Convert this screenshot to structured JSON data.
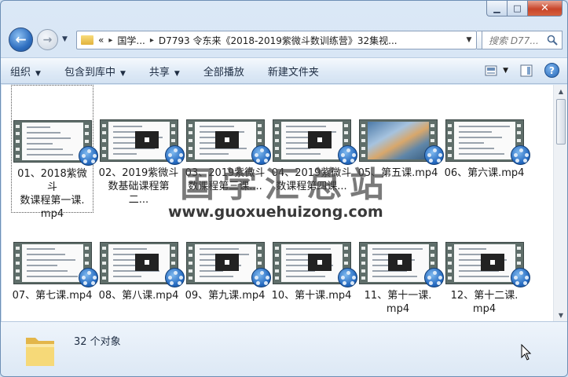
{
  "window": {
    "buttons": {
      "minimize": "▁",
      "maximize": "□",
      "close": "✕"
    }
  },
  "nav": {
    "back_icon": "arrow-left-icon",
    "forward_icon": "arrow-right-icon",
    "address": {
      "prefix": "«",
      "segments": [
        "国学...",
        "D7793 令东来《2018-2019紫微斗数训练营》32集视..."
      ]
    },
    "search_placeholder": "搜索 D77..."
  },
  "toolbar": {
    "items": [
      {
        "label": "组织",
        "dropdown": true
      },
      {
        "label": "包含到库中",
        "dropdown": true
      },
      {
        "label": "共享",
        "dropdown": true
      },
      {
        "label": "全部播放",
        "dropdown": false
      },
      {
        "label": "新建文件夹",
        "dropdown": false
      }
    ]
  },
  "files": [
    {
      "name": "01、2018紫微斗数课程第一课.mp4",
      "lines": [
        "01、2018紫微斗",
        "数课程第一课.",
        "mp4"
      ],
      "selected": true
    },
    {
      "name": "02、2019紫微斗数基础课程第二...",
      "lines": [
        "02、2019紫微斗",
        "数基础课程第二..."
      ],
      "selected": false
    },
    {
      "name": "03、2019紫微斗数课程第三课...",
      "lines": [
        "03、2019紫微斗",
        "数课程第三课...."
      ],
      "selected": false
    },
    {
      "name": "04、2019紫微斗数课程第四课...",
      "lines": [
        "04、2019紫微斗",
        "数课程第四课..."
      ],
      "selected": false
    },
    {
      "name": "05、第五课.mp4",
      "lines": [
        "05、第五课.mp4"
      ],
      "selected": false
    },
    {
      "name": "06、第六课.mp4",
      "lines": [
        "06、第六课.mp4"
      ],
      "selected": false
    },
    {
      "name": "07、第七课.mp4",
      "lines": [
        "07、第七课.mp4"
      ],
      "selected": false
    },
    {
      "name": "08、第八课.mp4",
      "lines": [
        "08、第八课.mp4"
      ],
      "selected": false
    },
    {
      "name": "09、第九课.mp4",
      "lines": [
        "09、第九课.mp4"
      ],
      "selected": false
    },
    {
      "name": "10、第十课.mp4",
      "lines": [
        "10、第十课.mp4"
      ],
      "selected": false
    },
    {
      "name": "11、第十一课.mp4",
      "lines": [
        "11、第十一课.",
        "mp4"
      ],
      "selected": false
    },
    {
      "name": "12、第十二课.mp4",
      "lines": [
        "12、第十二课.",
        "mp4"
      ],
      "selected": false
    }
  ],
  "watermark": {
    "cn": "国学汇总站",
    "url": "www.guoxuehuizong.com"
  },
  "status": {
    "count": "32 个对象"
  },
  "colors": {
    "accent": "#2f6fc0",
    "selection_border": "#555555"
  }
}
